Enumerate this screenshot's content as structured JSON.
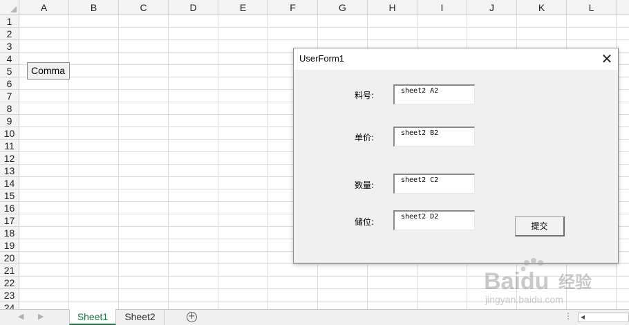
{
  "sheet": {
    "columns": [
      "A",
      "B",
      "C",
      "D",
      "E",
      "F",
      "G",
      "H",
      "I",
      "J",
      "K",
      "L"
    ],
    "rows": [
      "1",
      "2",
      "3",
      "4",
      "5",
      "6",
      "7",
      "8",
      "9",
      "10",
      "11",
      "12",
      "13",
      "14",
      "15",
      "16",
      "17",
      "18",
      "19",
      "20",
      "21",
      "22",
      "23",
      "24"
    ],
    "command_button_label": "Comma"
  },
  "tabs": {
    "active_label": "Sheet1",
    "inactive_label": "Sheet2",
    "add_symbol": "+",
    "nav_prev": "◀",
    "nav_next": "▶",
    "more_symbol": "⋮",
    "scroll_left": "◀"
  },
  "dialog": {
    "title": "UserForm1",
    "close_symbol": "✕",
    "fields": [
      {
        "label": "料号:",
        "value": "sheet2 A2"
      },
      {
        "label": "单价:",
        "value": "sheet2 B2"
      },
      {
        "label": "数量:",
        "value": "sheet2 C2"
      },
      {
        "label": "储位:",
        "value": "sheet2 D2"
      }
    ],
    "submit_label": "提交"
  },
  "watermark": {
    "brand": "Baidu",
    "suffix": "经验",
    "url": "jingyan.baidu.com"
  }
}
